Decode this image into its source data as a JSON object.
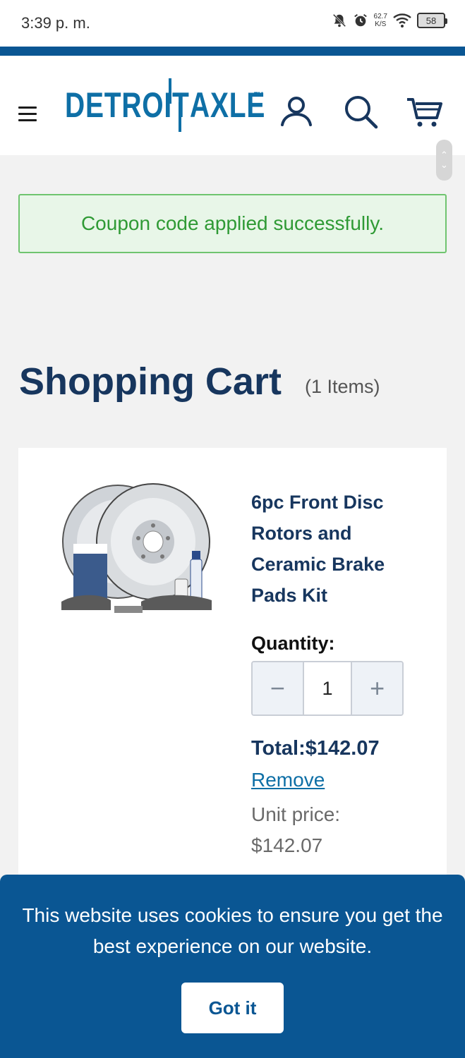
{
  "status_bar": {
    "time": "3:39 p. m.",
    "net_speed": "62.7",
    "net_unit": "K/S",
    "battery": "58",
    "icons": [
      "bell-muted-icon",
      "alarm-icon",
      "wifi-icon",
      "battery-icon"
    ]
  },
  "header": {
    "logo_left": "DETROIT",
    "logo_right": "AXLE",
    "logo_tm": "TM",
    "icons": [
      "menu-icon",
      "account-icon",
      "search-icon",
      "cart-icon"
    ],
    "accent_color": "#0e6fa6",
    "stripe_color": "#0a5693"
  },
  "coupon": {
    "message": "Coupon code applied successfully."
  },
  "cart": {
    "title": "Shopping Cart",
    "count_label": "(1 Items)",
    "items": [
      {
        "name": "6pc Front Disc Rotors and Ceramic Brake Pads Kit",
        "quantity_label": "Quantity:",
        "quantity": "1",
        "decrement": "−",
        "increment": "+",
        "total": "Total:$142.07",
        "remove": "Remove",
        "unit_price_label": "Unit price:",
        "unit_price": "$142.07"
      }
    ]
  },
  "cookie_banner": {
    "text": "This website uses cookies to ensure you get the best experience on our website.",
    "button": "Got it"
  }
}
